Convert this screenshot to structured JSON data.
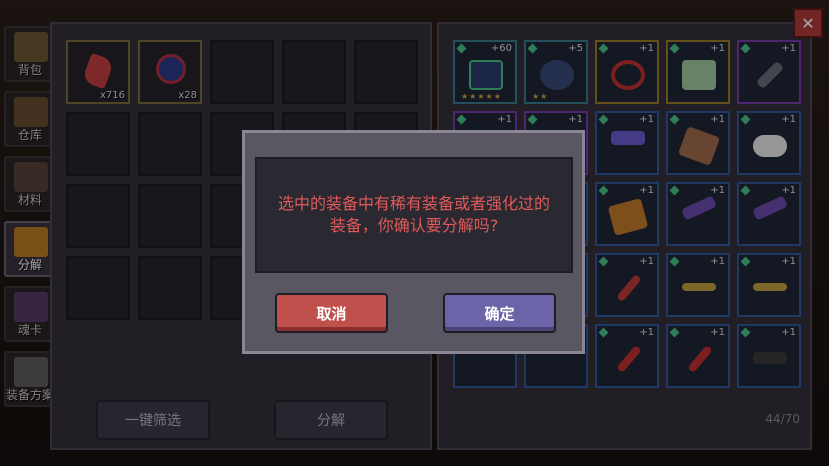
{
  "sidebar": {
    "tabs": [
      {
        "label": "背包",
        "color": "#a08040"
      },
      {
        "label": "仓库",
        "color": "#9a6a3a"
      },
      {
        "label": "材料",
        "color": "#7a5a4a"
      },
      {
        "label": "分解",
        "color": "#d08a20"
      },
      {
        "label": "魂卡",
        "color": "#7a4aa0"
      },
      {
        "label": "装备方案",
        "color": "#8a8a8a"
      }
    ]
  },
  "materials": [
    {
      "count": "x716",
      "icon": "red-crystal-icon"
    },
    {
      "count": "x28",
      "icon": "dark-orb-icon"
    }
  ],
  "left_buttons": {
    "filter_label": "一键筛选",
    "decompose_label": "分解"
  },
  "equipment": {
    "capacity": "44/70",
    "row1": [
      {
        "level": "+60",
        "stars": "★★★★★"
      },
      {
        "level": "+5",
        "stars": "★★"
      },
      {
        "level": "+1"
      },
      {
        "level": "+1"
      },
      {
        "level": "+1"
      }
    ],
    "level_label": "+1"
  },
  "dialog": {
    "message": "选中的装备中有稀有装备或者强化过的\n装备，你确认要分解吗?",
    "cancel_label": "取消",
    "confirm_label": "确定"
  },
  "close_label": "✕"
}
